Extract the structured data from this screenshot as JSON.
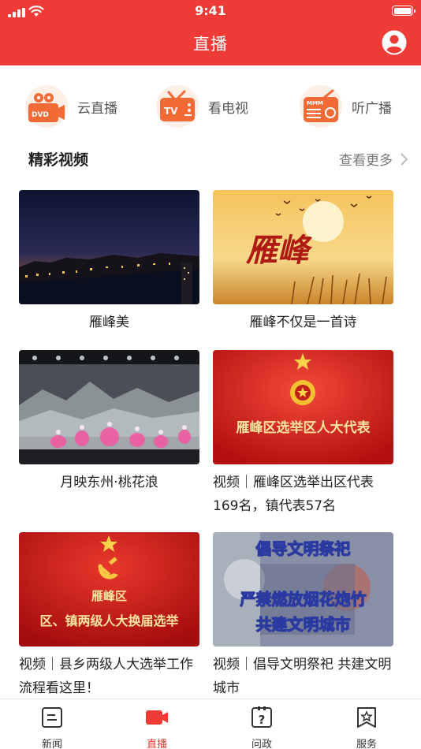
{
  "status": {
    "time": "9:41"
  },
  "header": {
    "title": "直播",
    "profile_icon": "user-circle-icon"
  },
  "quick_entries": [
    {
      "label": "云直播",
      "icon": "dvd-camera-icon"
    },
    {
      "label": "看电视",
      "icon": "tv-icon"
    },
    {
      "label": "听广播",
      "icon": "radio-icon"
    }
  ],
  "section": {
    "title": "精彩视频",
    "more": "查看更多"
  },
  "videos": [
    {
      "caption": "雁峰美",
      "thumb": "night-city-river"
    },
    {
      "caption": "雁峰不仅是一首诗",
      "thumb": "sunset-geese-calligraphy",
      "thumb_text": "雁峰"
    },
    {
      "caption": "月映东州·桃花浪",
      "thumb": "stage-dance"
    },
    {
      "caption": "视频｜雁峰区选举出区代表169名，镇代表57名",
      "thumb": "red-emblem-banner",
      "thumb_text": "雁峰区选举区人大代表"
    },
    {
      "caption": "视频｜县乡两级人大选举工作流程看这里！",
      "thumb": "red-party-banner",
      "thumb_text_1": "雁峰区",
      "thumb_text_2": "区、镇两级人大换届选举"
    },
    {
      "caption": "视频｜倡导文明祭祀 共建文明城市",
      "thumb": "civilized-sacrifice-poster",
      "thumb_text_1": "倡导文明祭祀",
      "thumb_text_2": "严禁燃放烟花炮竹",
      "thumb_text_3": "共建文明城市"
    }
  ],
  "tabbar": [
    {
      "label": "新闻",
      "icon": "news-icon",
      "active": false
    },
    {
      "label": "直播",
      "icon": "video-camera-icon",
      "active": true
    },
    {
      "label": "问政",
      "icon": "question-icon",
      "active": false
    },
    {
      "label": "服务",
      "icon": "service-star-icon",
      "active": false
    }
  ],
  "colors": {
    "brand": "#ee3b36",
    "tab_active": "#e8392f",
    "icon_orange": "#f26a35"
  }
}
